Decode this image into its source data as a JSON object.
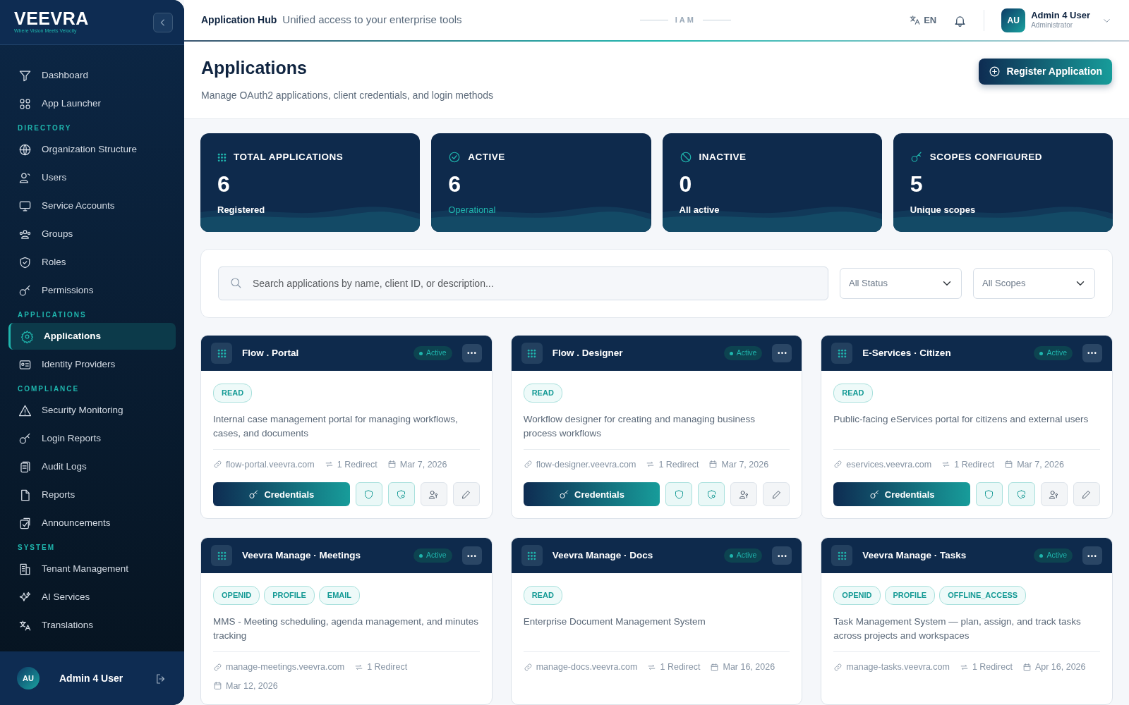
{
  "sidebar": {
    "logo": {
      "name": "VEEVRA",
      "tagline": "Where Vision Meets Velocity"
    },
    "sections": [
      {
        "items": [
          {
            "label": "Dashboard",
            "selected": false
          },
          {
            "label": "App Launcher",
            "selected": false
          }
        ]
      },
      {
        "heading": "DIRECTORY",
        "items": [
          {
            "label": "Organization Structure",
            "selected": false
          },
          {
            "label": "Users",
            "selected": false
          },
          {
            "label": "Service Accounts",
            "selected": false
          },
          {
            "label": "Groups",
            "selected": false
          },
          {
            "label": "Roles",
            "selected": false
          },
          {
            "label": "Permissions",
            "selected": false
          }
        ]
      },
      {
        "heading": "APPLICATIONS",
        "items": [
          {
            "label": "Applications",
            "selected": true
          },
          {
            "label": "Identity Providers",
            "selected": false
          }
        ]
      },
      {
        "heading": "COMPLIANCE",
        "items": [
          {
            "label": "Security Monitoring",
            "selected": false
          },
          {
            "label": "Login Reports",
            "selected": false
          },
          {
            "label": "Audit Logs",
            "selected": false
          },
          {
            "label": "Reports",
            "selected": false
          },
          {
            "label": "Announcements",
            "selected": false
          }
        ]
      },
      {
        "heading": "SYSTEM",
        "items": [
          {
            "label": "Tenant Management",
            "selected": false
          },
          {
            "label": "AI Services",
            "selected": false
          },
          {
            "label": "Translations",
            "selected": false
          }
        ]
      }
    ],
    "user": {
      "initials": "AU",
      "name": "Admin 4 User"
    }
  },
  "header": {
    "title": "Application Hub",
    "subtitle": "Unified access to your enterprise tools",
    "badge": "IAM",
    "language": "EN",
    "user": {
      "initials": "AU",
      "name": "Admin 4 User",
      "role": "Administrator"
    }
  },
  "page": {
    "title": "Applications",
    "subtitle": "Manage OAuth2 applications, client credentials, and login methods",
    "primary_action": "Register Application"
  },
  "stats": [
    {
      "label": "TOTAL APPLICATIONS",
      "value": "6",
      "caption": "Registered",
      "highlight": false
    },
    {
      "label": "ACTIVE",
      "value": "6",
      "caption": "Operational",
      "highlight": true
    },
    {
      "label": "INACTIVE",
      "value": "0",
      "caption": "All active",
      "highlight": false
    },
    {
      "label": "SCOPES CONFIGURED",
      "value": "5",
      "caption": "Unique scopes",
      "highlight": false
    }
  ],
  "filters": {
    "search_placeholder": "Search applications by name, client ID, or description...",
    "selects": [
      "All Status",
      "All Scopes"
    ]
  },
  "apps": [
    {
      "name": "Flow . Portal",
      "status": "Active",
      "scopes": [
        "READ"
      ],
      "description": "Internal case management portal for managing workflows, cases, and documents",
      "url": "flow-portal.veevra.com",
      "redirects": "1 Redirect",
      "date": "Mar 7, 2026",
      "credentials_label": "Credentials"
    },
    {
      "name": "Flow . Designer",
      "status": "Active",
      "scopes": [
        "READ"
      ],
      "description": "Workflow designer for creating and managing business process workflows",
      "url": "flow-designer.veevra.com",
      "redirects": "1 Redirect",
      "date": "Mar 7, 2026",
      "credentials_label": "Credentials"
    },
    {
      "name": "E-Services · Citizen",
      "status": "Active",
      "scopes": [
        "READ"
      ],
      "description": "Public-facing eServices portal for citizens and external users",
      "url": "eservices.veevra.com",
      "redirects": "1 Redirect",
      "date": "Mar 7, 2026",
      "credentials_label": "Credentials"
    },
    {
      "name": "Veevra Manage · Meetings",
      "status": "Active",
      "scopes": [
        "OPENID",
        "PROFILE",
        "EMAIL"
      ],
      "description": "MMS - Meeting scheduling, agenda management, and minutes tracking",
      "url": "manage-meetings.veevra.com",
      "redirects": "1 Redirect",
      "date": "Mar 12, 2026"
    },
    {
      "name": "Veevra Manage · Docs",
      "status": "Active",
      "scopes": [
        "READ"
      ],
      "description": "Enterprise Document Management System",
      "url": "manage-docs.veevra.com",
      "redirects": "1 Redirect",
      "date": "Mar 16, 2026"
    },
    {
      "name": "Veevra Manage · Tasks",
      "status": "Active",
      "scopes": [
        "OPENID",
        "PROFILE",
        "OFFLINE_ACCESS"
      ],
      "description": "Task Management System — plan, assign, and track tasks across projects and workspaces",
      "url": "manage-tasks.veevra.com",
      "redirects": "1 Redirect",
      "date": "Apr 16, 2026"
    }
  ]
}
